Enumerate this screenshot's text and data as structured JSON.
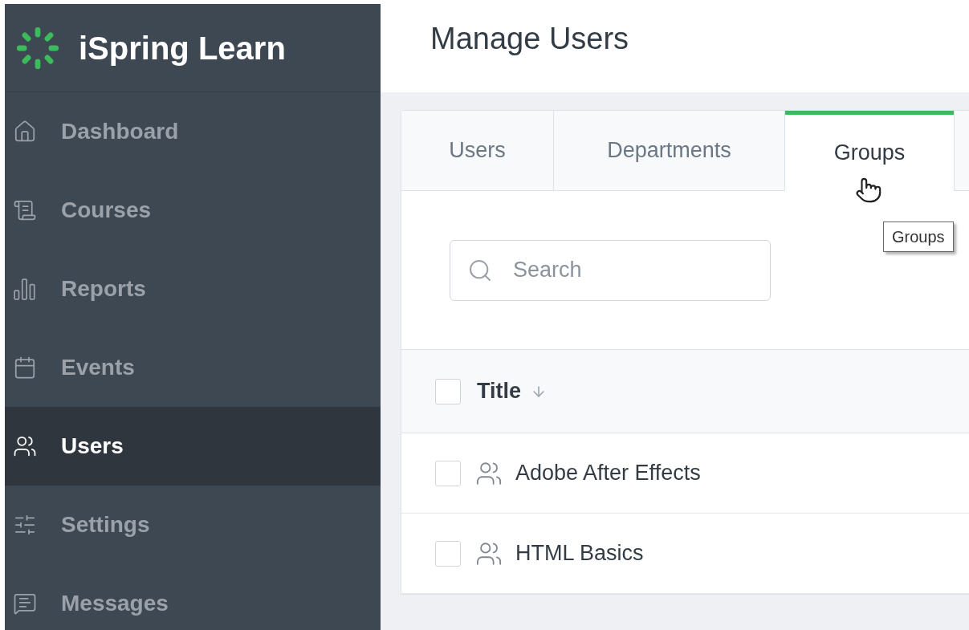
{
  "sidebar": {
    "brand": "iSpring Learn",
    "items": [
      {
        "label": "Dashboard",
        "selected": false
      },
      {
        "label": "Courses",
        "selected": false
      },
      {
        "label": "Reports",
        "selected": false
      },
      {
        "label": "Events",
        "selected": false
      },
      {
        "label": "Users",
        "selected": true
      },
      {
        "label": "Settings",
        "selected": false
      },
      {
        "label": "Messages",
        "selected": false
      }
    ]
  },
  "page_title": "Manage Users",
  "tabs": [
    {
      "label": "Users",
      "selected": false
    },
    {
      "label": "Departments",
      "selected": false
    },
    {
      "label": "Groups",
      "selected": true
    }
  ],
  "tooltip": "Groups",
  "search": {
    "placeholder": "Search"
  },
  "table": {
    "header": {
      "label": "Title",
      "checked": false
    },
    "rows": [
      {
        "title": "Adobe After Effects",
        "checked": false
      },
      {
        "title": "HTML Basics",
        "checked": false
      }
    ]
  }
}
